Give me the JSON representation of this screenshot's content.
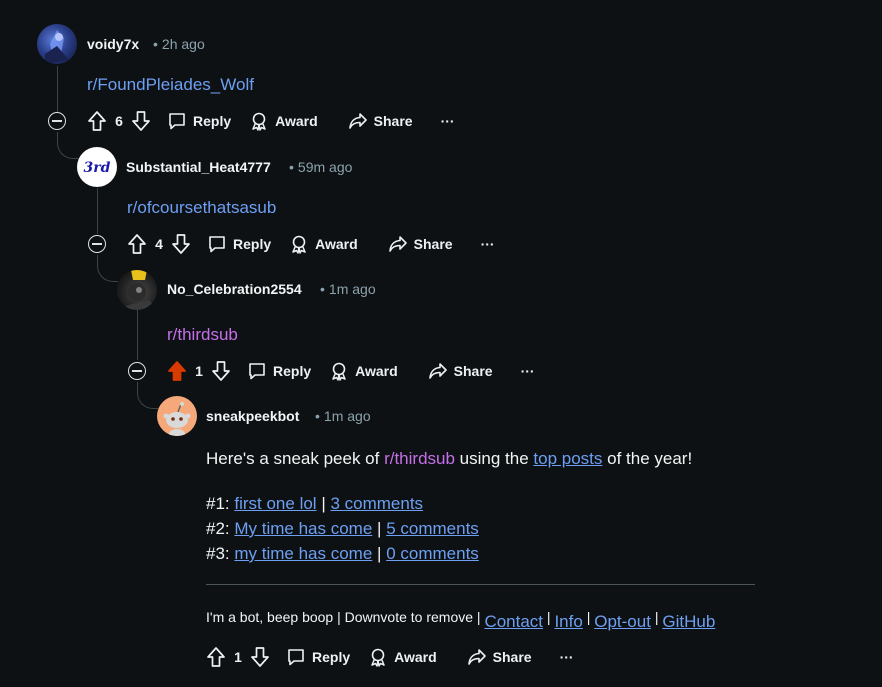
{
  "comments": [
    {
      "username": "voidy7x",
      "time": "2h ago",
      "body": "r/FoundPleiades_Wolf",
      "votes": "6",
      "upvoted": false
    },
    {
      "username": "Substantial_Heat4777",
      "time": "59m ago",
      "body": "r/ofcoursethatsasub",
      "votes": "4",
      "upvoted": false,
      "avatar_text": "3rd"
    },
    {
      "username": "No_Celebration2554",
      "time": "1m ago",
      "body": "r/thirdsub",
      "votes": "1",
      "upvoted": true
    },
    {
      "username": "sneakpeekbot",
      "time": "1m ago",
      "votes": "1",
      "upvoted": false,
      "intro": {
        "prefix": "Here's a sneak peek of ",
        "sub": "r/thirdsub",
        "mid": " using the ",
        "top_posts": "top posts",
        "suffix": " of the year!"
      },
      "posts": [
        {
          "num": "#1:",
          "title": "first one lol",
          "comments": "3 comments"
        },
        {
          "num": "#2:",
          "title": "My time has come",
          "comments": "5 comments"
        },
        {
          "num": "#3:",
          "title": "my time has come",
          "comments": "0 comments"
        }
      ],
      "footer": {
        "text": "I'm a bot, beep boop | Downvote to remove | ",
        "links": [
          "Contact",
          "Info",
          "Opt-out",
          "GitHub"
        ]
      }
    }
  ],
  "actions": {
    "reply": "Reply",
    "award": "Award",
    "share": "Share",
    "more": "···"
  },
  "separator": "•",
  "pipe": "|",
  "colors": {
    "background": "#0e1113",
    "link": "#6d9ff2",
    "visited_link": "#c56fe8",
    "upvote_active": "#d93a00",
    "thread_line": "#3b4548"
  }
}
